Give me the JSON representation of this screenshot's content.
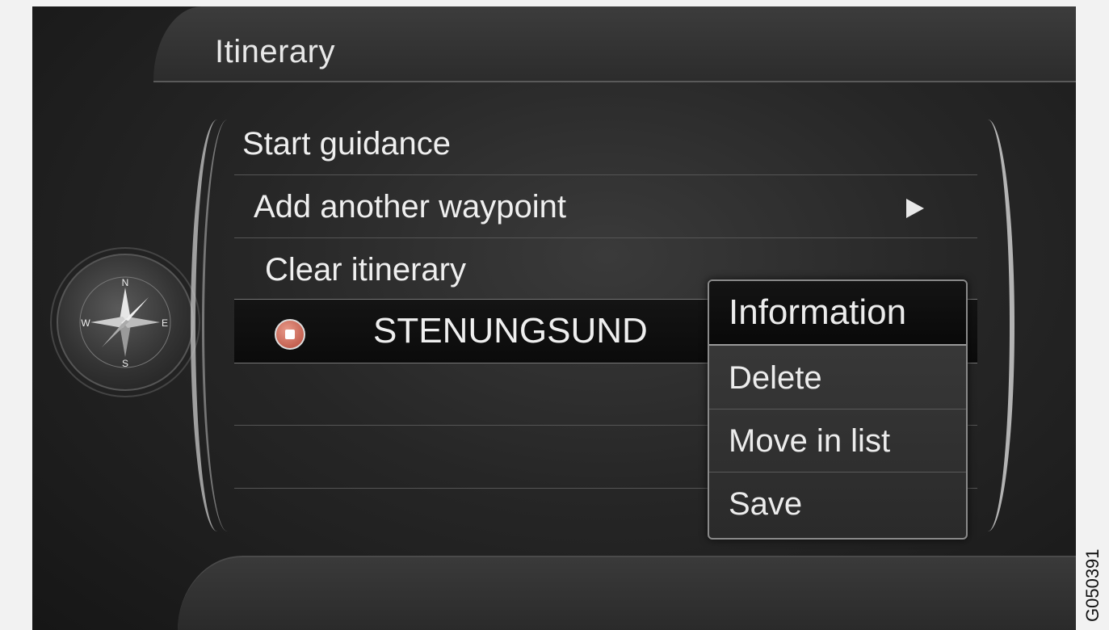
{
  "header": {
    "title": "Itinerary"
  },
  "compass": {
    "north": "N",
    "south": "S",
    "east": "E",
    "west": "W"
  },
  "menu": {
    "items": [
      {
        "label": "Start guidance",
        "has_submenu": false
      },
      {
        "label": "Add another waypoint",
        "has_submenu": true
      },
      {
        "label": "Clear itinerary",
        "has_submenu": false
      },
      {
        "label": "STENUNGSUND",
        "selected": true,
        "icon": "waypoint-icon"
      }
    ]
  },
  "popup": {
    "items": [
      {
        "label": "Information",
        "active": true
      },
      {
        "label": "Delete"
      },
      {
        "label": "Move in list"
      },
      {
        "label": "Save"
      }
    ]
  },
  "figure_code": "G050391",
  "colors": {
    "background": "#1e1e1e",
    "text": "#efefef",
    "waypoint": "#b54a3a"
  }
}
